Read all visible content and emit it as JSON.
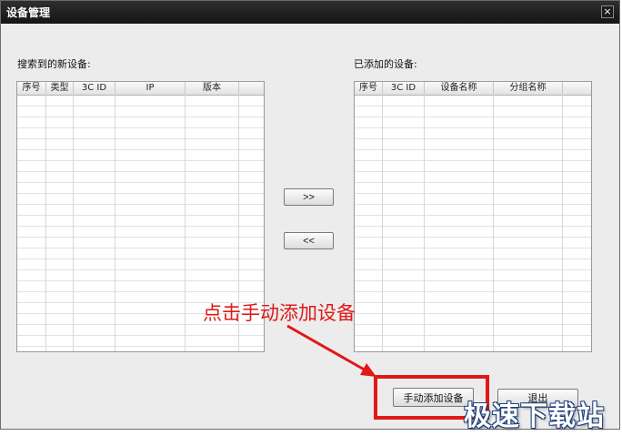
{
  "window": {
    "title": "设备管理",
    "close_label": "×"
  },
  "left_panel": {
    "label": "搜索到的新设备:",
    "columns": [
      "序号",
      "类型",
      "3C ID",
      "IP",
      "版本"
    ]
  },
  "right_panel": {
    "label": "已添加的设备:",
    "columns": [
      "序号",
      "3C ID",
      "设备名称",
      "分组名称"
    ]
  },
  "move_buttons": {
    "add": ">>",
    "remove": "<<"
  },
  "bottom_buttons": {
    "manual_add": "手动添加设备",
    "exit": "退出"
  },
  "annotation": {
    "text": "点击手动添加设备",
    "color": "#e01818"
  },
  "watermark": {
    "text": "极速下载站"
  }
}
